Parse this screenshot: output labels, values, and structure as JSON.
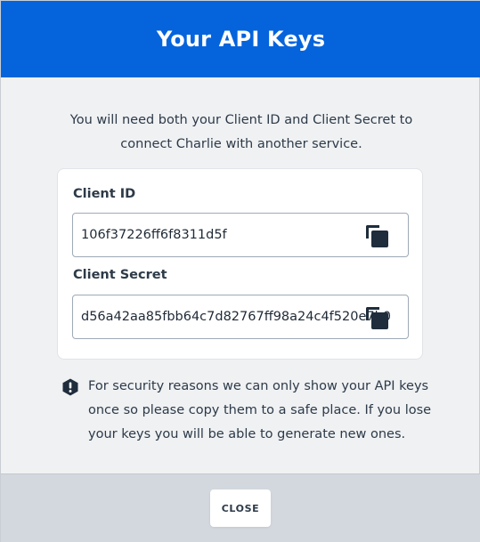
{
  "modal": {
    "title": "Your API Keys",
    "intro": "You will need both your Client ID and Client Secret to connect Charlie with another service.",
    "accent_color": "#0564dc"
  },
  "client_id": {
    "label": "Client ID",
    "value": "106f37226ff6f8311d5f",
    "copy_icon": "copy-icon"
  },
  "client_secret": {
    "label": "Client Secret",
    "value": "d56a42aa85fbb64c7d82767ff98a24c4f520e7b0",
    "copy_icon": "copy-icon"
  },
  "notice": {
    "icon": "alert-hexagon-icon",
    "text": "For security reasons we can only show your API keys once so please copy them to a safe place. If you lose your keys you will be able to generate new ones."
  },
  "footer": {
    "close_label": "CLOSE"
  }
}
